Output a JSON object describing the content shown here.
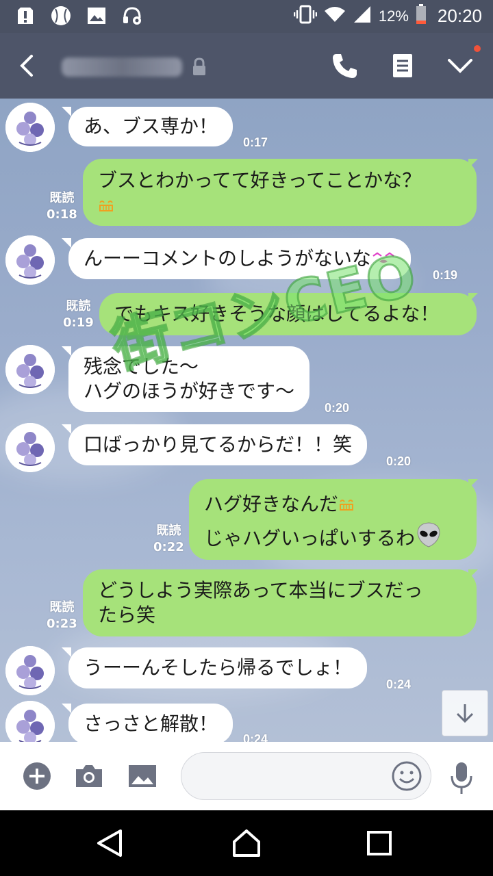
{
  "status_bar": {
    "battery_percent": "12%",
    "time": "20:20",
    "icons": [
      "alert-icon",
      "baseball-icon",
      "image-icon",
      "headset-icon",
      "vibrate-icon",
      "wifi-icon",
      "signal-icon",
      "battery-icon"
    ]
  },
  "header": {
    "contact_name": "",
    "icons": [
      "back-icon",
      "lock-icon",
      "phone-icon",
      "note-icon",
      "chevron-down-icon"
    ]
  },
  "watermark": "街コンCEO",
  "messages": [
    {
      "side": "in",
      "text": "あ、ブス専か！",
      "time": "0:17"
    },
    {
      "side": "out",
      "text": "ブスとわかってて好きってことかな？",
      "emoji": "smile-emoji",
      "read": "既読",
      "time": "0:18"
    },
    {
      "side": "in",
      "text": "んーーコメントのしようがないな",
      "emoji": "kiss-emoji",
      "time": "0:19"
    },
    {
      "side": "out",
      "text": "でもキス好きそうな顔はしてるよな！",
      "read": "既読",
      "time": "0:19"
    },
    {
      "side": "in",
      "lines": [
        "残念でした〜",
        "ハグのほうが好きです〜"
      ],
      "time": "0:20"
    },
    {
      "side": "in",
      "text": "口ばっかり見てるからだ！！笑",
      "time": "0:20"
    },
    {
      "side": "out",
      "lines": [
        "ハグ好きなんだ",
        "じゃハグいっぱいするわ"
      ],
      "emoji": [
        "smile-emoji",
        "alien-emoji"
      ],
      "read": "既読",
      "time": "0:22"
    },
    {
      "side": "out",
      "lines": [
        "どうしよう実際あって本当にブスだっ",
        "たら笑"
      ],
      "read": "既読",
      "time": "0:23"
    },
    {
      "side": "in",
      "text": "うーーんそしたら帰るでしょ！",
      "time": "0:24"
    },
    {
      "side": "in",
      "text": "さっさと解散！",
      "time": "0:24"
    }
  ],
  "input_bar": {
    "placeholder": "",
    "icons": [
      "plus-icon",
      "camera-icon",
      "image-icon",
      "emoji-icon",
      "mic-icon"
    ]
  },
  "nav_bar": {
    "icons": [
      "back-triangle-icon",
      "home-icon",
      "recents-icon"
    ]
  },
  "colors": {
    "header": "#4e5569",
    "bubble_out": "#a6e27a",
    "bubble_in": "#ffffff",
    "status_bar": "#4a5163"
  }
}
